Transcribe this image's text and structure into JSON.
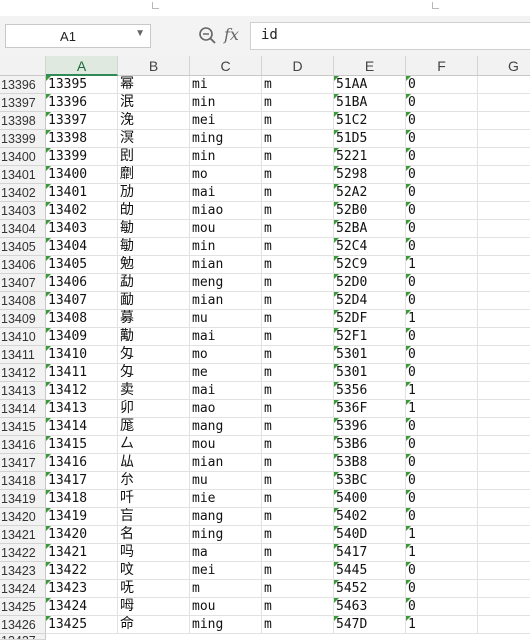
{
  "name_box": {
    "value": "A1"
  },
  "formula_bar": {
    "fx_label": "fx",
    "content": "id"
  },
  "columns": [
    "A",
    "B",
    "C",
    "D",
    "E",
    "F",
    "G"
  ],
  "rows": [
    {
      "num": "13396",
      "cells": [
        "13395",
        "幂",
        "mi",
        "m",
        "51AA",
        "0"
      ]
    },
    {
      "num": "13397",
      "cells": [
        "13396",
        "泯",
        "min",
        "m",
        "51BA",
        "0"
      ]
    },
    {
      "num": "13398",
      "cells": [
        "13397",
        "浼",
        "mei",
        "m",
        "51C2",
        "0"
      ]
    },
    {
      "num": "13399",
      "cells": [
        "13398",
        "溟",
        "ming",
        "m",
        "51D5",
        "0"
      ]
    },
    {
      "num": "13400",
      "cells": [
        "13399",
        "刡",
        "min",
        "m",
        "5221",
        "0"
      ]
    },
    {
      "num": "13401",
      "cells": [
        "13400",
        "劘",
        "mo",
        "m",
        "5298",
        "0"
      ]
    },
    {
      "num": "13402",
      "cells": [
        "13401",
        "劢",
        "mai",
        "m",
        "52A2",
        "0"
      ]
    },
    {
      "num": "13403",
      "cells": [
        "13402",
        "劰",
        "miao",
        "m",
        "52B0",
        "0"
      ]
    },
    {
      "num": "13404",
      "cells": [
        "13403",
        "勄",
        "mou",
        "m",
        "52BA",
        "0"
      ]
    },
    {
      "num": "13405",
      "cells": [
        "13404",
        "勄",
        "min",
        "m",
        "52C4",
        "0"
      ]
    },
    {
      "num": "13406",
      "cells": [
        "13405",
        "勉",
        "mian",
        "m",
        "52C9",
        "1"
      ]
    },
    {
      "num": "13407",
      "cells": [
        "13406",
        "勐",
        "meng",
        "m",
        "52D0",
        "0"
      ]
    },
    {
      "num": "13408",
      "cells": [
        "13407",
        "勔",
        "mian",
        "m",
        "52D4",
        "0"
      ]
    },
    {
      "num": "13409",
      "cells": [
        "13408",
        "募",
        "mu",
        "m",
        "52DF",
        "1"
      ]
    },
    {
      "num": "13410",
      "cells": [
        "13409",
        "勱",
        "mai",
        "m",
        "52F1",
        "0"
      ]
    },
    {
      "num": "13411",
      "cells": [
        "13410",
        "匁",
        "mo",
        "m",
        "5301",
        "0"
      ]
    },
    {
      "num": "13412",
      "cells": [
        "13411",
        "匁",
        "me",
        "m",
        "5301",
        "0"
      ]
    },
    {
      "num": "13413",
      "cells": [
        "13412",
        "卖",
        "mai",
        "m",
        "5356",
        "1"
      ]
    },
    {
      "num": "13414",
      "cells": [
        "13413",
        "卯",
        "mao",
        "m",
        "536F",
        "1"
      ]
    },
    {
      "num": "13415",
      "cells": [
        "13414",
        "厖",
        "mang",
        "m",
        "5396",
        "0"
      ]
    },
    {
      "num": "13416",
      "cells": [
        "13415",
        "厶",
        "mou",
        "m",
        "53B6",
        "0"
      ]
    },
    {
      "num": "13417",
      "cells": [
        "13416",
        "厸",
        "mian",
        "m",
        "53B8",
        "0"
      ]
    },
    {
      "num": "13418",
      "cells": [
        "13417",
        "厼",
        "mu",
        "m",
        "53BC",
        "0"
      ]
    },
    {
      "num": "13419",
      "cells": [
        "13418",
        "吀",
        "mie",
        "m",
        "5400",
        "0"
      ]
    },
    {
      "num": "13420",
      "cells": [
        "13419",
        "吂",
        "mang",
        "m",
        "5402",
        "0"
      ]
    },
    {
      "num": "13421",
      "cells": [
        "13420",
        "名",
        "ming",
        "m",
        "540D",
        "1"
      ]
    },
    {
      "num": "13422",
      "cells": [
        "13421",
        "吗",
        "ma",
        "m",
        "5417",
        "1"
      ]
    },
    {
      "num": "13423",
      "cells": [
        "13422",
        "呅",
        "mei",
        "m",
        "5445",
        "0"
      ]
    },
    {
      "num": "13424",
      "cells": [
        "13423",
        "呒",
        "m",
        "m",
        "5452",
        "0"
      ]
    },
    {
      "num": "13425",
      "cells": [
        "13424",
        "呣",
        "mou",
        "m",
        "5463",
        "0"
      ]
    },
    {
      "num": "13426",
      "cells": [
        "13425",
        "命",
        "ming",
        "m",
        "547D",
        "1"
      ]
    }
  ],
  "partial_row": {
    "num": "13427"
  },
  "colors": {
    "selected_header_bg": "#dfe9df",
    "selected_header_text": "#1d6b3a",
    "error_triangle": "#3a9a3a"
  }
}
